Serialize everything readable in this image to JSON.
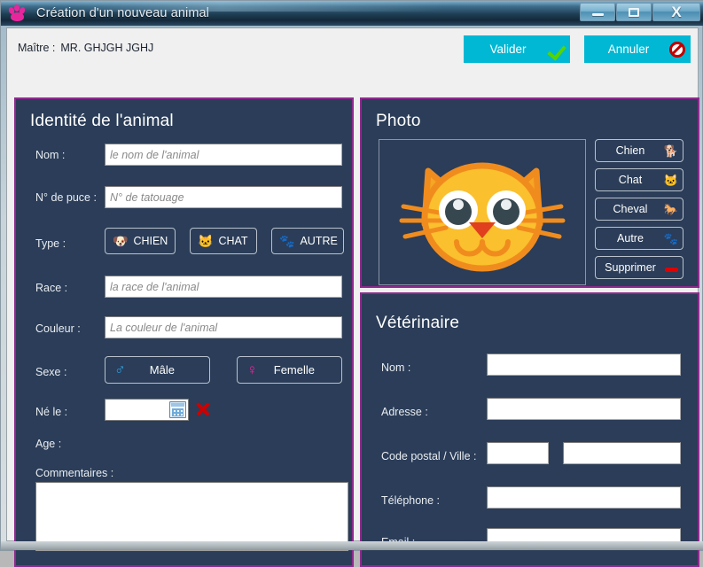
{
  "window": {
    "title": "Création d'un nouveau animal",
    "icon": "paw-icon",
    "controls": {
      "minimize": "minimize-icon",
      "maximize": "maximize-icon",
      "close": "X"
    }
  },
  "topbar": {
    "maitre_label": "Maître :",
    "maitre_value": "MR. GHJGH JGHJ",
    "valider_label": "Valider",
    "annuler_label": "Annuler"
  },
  "identite": {
    "title": "Identité de l'animal",
    "nom_label": "Nom :",
    "nom_placeholder": "le nom de l'animal",
    "nom_value": "",
    "puce_label": "N° de puce :",
    "puce_placeholder": "N° de tatouage",
    "puce_value": "",
    "type_label": "Type :",
    "type_options": [
      {
        "label": "CHIEN",
        "emoji": "🐶"
      },
      {
        "label": "CHAT",
        "emoji": "🐱"
      },
      {
        "label": "AUTRE",
        "emoji": "🐾"
      }
    ],
    "race_label": "Race :",
    "race_placeholder": "la race de l'animal",
    "race_value": "",
    "couleur_label": "Couleur :",
    "couleur_placeholder": "La couleur de l'animal",
    "couleur_value": "",
    "sexe_label": "Sexe :",
    "sexe_options": [
      {
        "label": "Mâle",
        "symbol": "♂"
      },
      {
        "label": "Femelle",
        "symbol": "♀"
      }
    ],
    "ne_le_label": "Né le :",
    "ne_le_value": "",
    "age_label": "Age :",
    "age_value": "",
    "commentaires_label": "Commentaires :",
    "commentaires_value": ""
  },
  "photo": {
    "title": "Photo",
    "image": "cat-face-photo",
    "buttons": [
      {
        "label": "Chien",
        "icon": "🐕"
      },
      {
        "label": "Chat",
        "icon": "🐱"
      },
      {
        "label": "Cheval",
        "icon": "🐎"
      },
      {
        "label": "Autre",
        "icon": "🐾"
      },
      {
        "label": "Supprimer",
        "icon": "minus-red"
      }
    ]
  },
  "veterinaire": {
    "title": "Vétérinaire",
    "nom_label": "Nom :",
    "nom_value": "",
    "adresse_label": "Adresse :",
    "adresse_value": "",
    "cp_ville_label": "Code postal / Ville :",
    "cp_value": "",
    "ville_value": "",
    "telephone_label": "Téléphone :",
    "telephone_value": "",
    "email_label": "Email :",
    "email_value": ""
  },
  "colors": {
    "panel_bg": "#2b3d58",
    "panel_border": "#8e2a8e",
    "accent_button": "#00b8d4",
    "titlebar_dark": "#1d3c52",
    "paw_pink": "#e8269c",
    "male_blue": "#2e9fe0",
    "female_pink": "#e8269c",
    "check_green": "#57d400",
    "ban_red": "#c00000"
  }
}
